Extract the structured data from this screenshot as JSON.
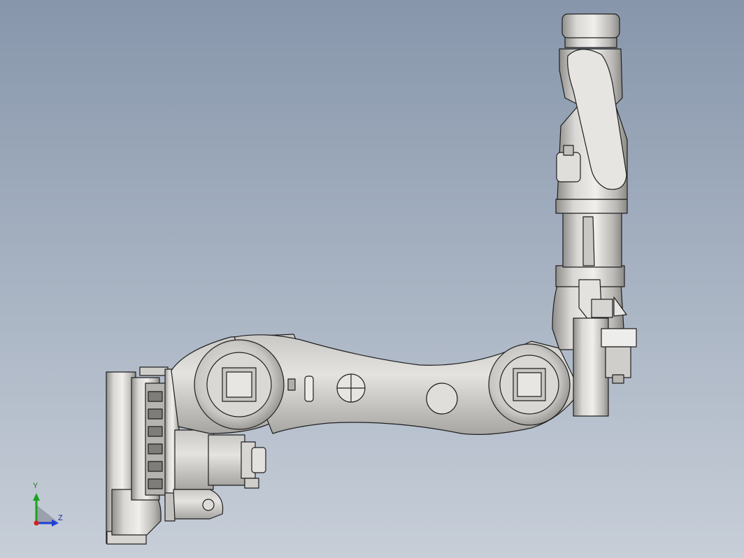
{
  "viewport": {
    "background_top": "#8796ab",
    "background_bottom": "#c7ced8"
  },
  "model": {
    "part_fill": "#d2d1ce",
    "part_shade": "#9c9b98",
    "edge_color": "#1f1f1f"
  },
  "triad": {
    "y_label": "Y",
    "z_label": "Z",
    "y_color": "#19a319",
    "z_color": "#1f3fd6",
    "x_color": "#d61f1f"
  }
}
